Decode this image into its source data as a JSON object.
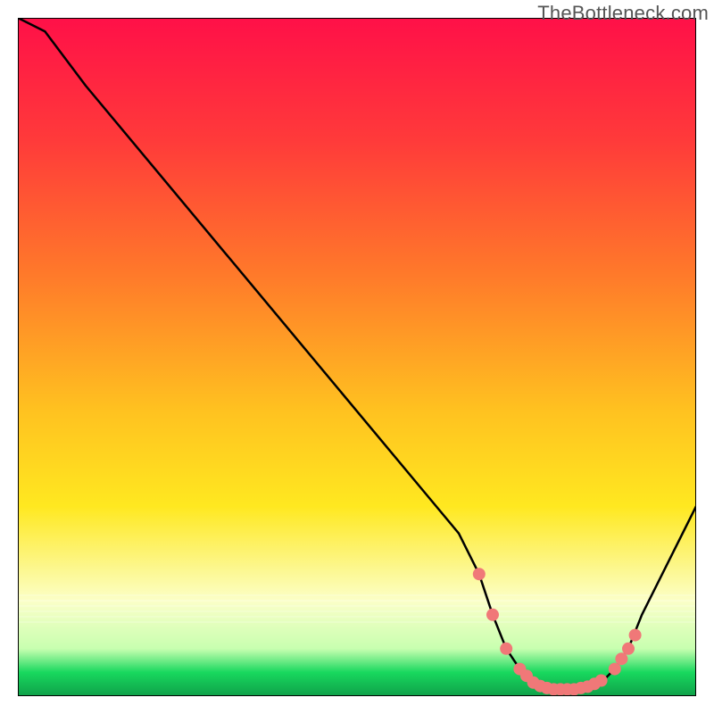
{
  "watermark": "TheBottleneck.com",
  "colors": {
    "gradient_top": "#ff1048",
    "gradient_upper_orange": "#ff7a2a",
    "gradient_mid_yellow": "#ffe820",
    "gradient_pale": "#fbffc8",
    "gradient_green": "#18d85e",
    "gradient_green_dark": "#0fa049",
    "black": "#000000",
    "marker": "#f07878"
  },
  "chart_data": {
    "type": "line",
    "title": "",
    "xlabel": "",
    "ylabel": "",
    "xlim": [
      0,
      100
    ],
    "ylim": [
      0,
      100
    ],
    "series": [
      {
        "name": "bottleneck-curve",
        "x": [
          0,
          4,
          10,
          20,
          30,
          40,
          50,
          60,
          65,
          68,
          70,
          72,
          74,
          76,
          78,
          80,
          82,
          84,
          86,
          88,
          90,
          92,
          95,
          100
        ],
        "y": [
          100,
          98,
          90,
          78,
          66,
          54,
          42,
          30,
          24,
          18,
          12,
          7,
          4,
          2,
          1.2,
          1,
          1,
          1.2,
          2,
          4,
          7,
          12,
          18,
          28
        ]
      }
    ],
    "markers": {
      "name": "highlight-dots",
      "x": [
        68,
        70,
        72,
        74,
        75,
        76,
        77,
        78,
        79,
        80,
        81,
        82,
        83,
        84,
        85,
        86,
        88,
        89,
        90,
        91
      ],
      "y": [
        18,
        12,
        7,
        4,
        3,
        2,
        1.5,
        1.2,
        1,
        1,
        1,
        1,
        1.2,
        1.4,
        1.8,
        2.3,
        4,
        5.5,
        7,
        9
      ]
    }
  }
}
